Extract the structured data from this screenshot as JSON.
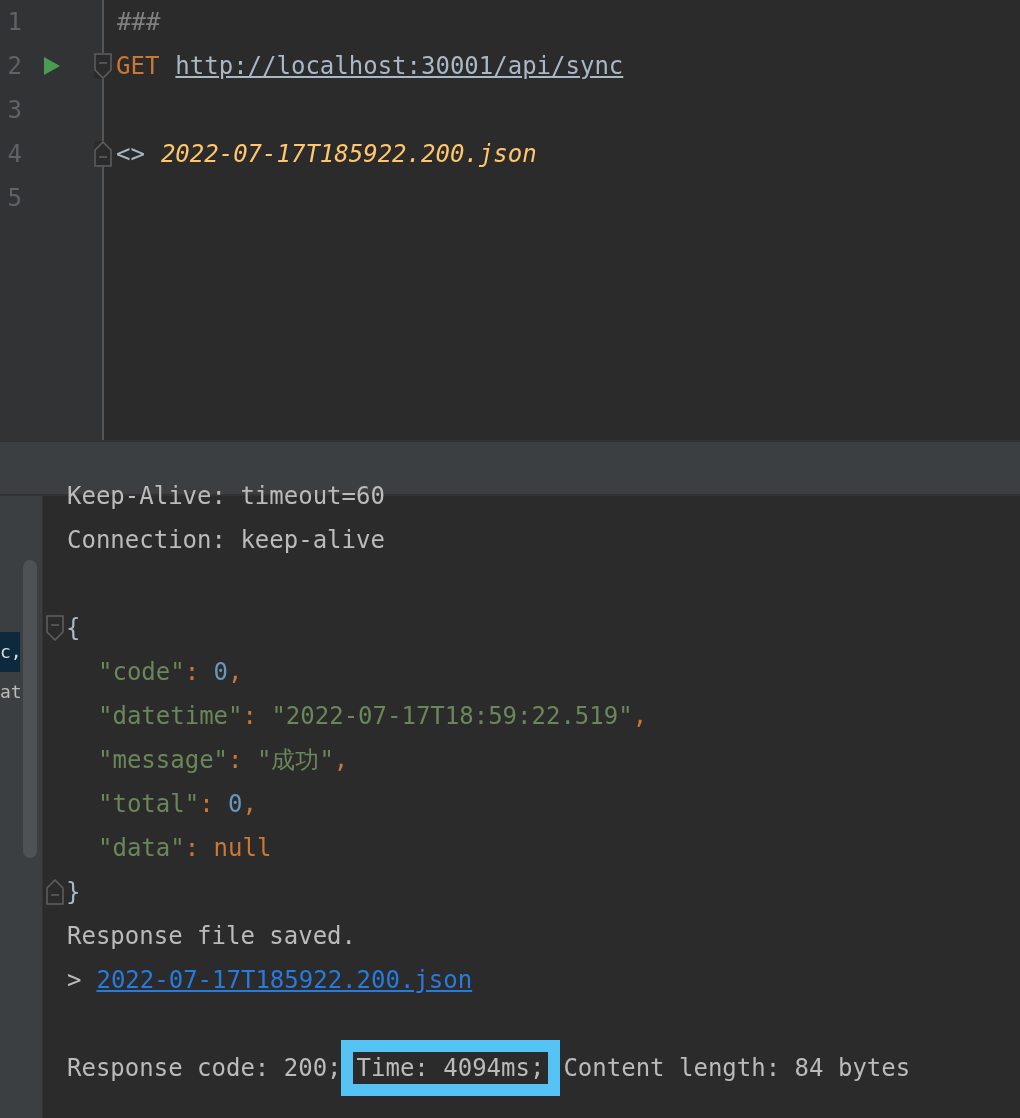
{
  "editor": {
    "lines": [
      {
        "number": "1",
        "kind": "comment",
        "text": "###"
      },
      {
        "number": "2",
        "kind": "request",
        "method": "GET",
        "url": "http://localhost:30001/api/sync",
        "runnable": true
      },
      {
        "number": "3",
        "kind": "blank"
      },
      {
        "number": "4",
        "kind": "response_ref",
        "marker": "<>",
        "file": "2022-07-17T185922.200.json"
      },
      {
        "number": "5",
        "kind": "blank"
      }
    ]
  },
  "side_panel": {
    "items": [
      {
        "text": "c,",
        "selected": true
      },
      {
        "text": "at",
        "selected": false
      }
    ]
  },
  "console": {
    "lines": [
      {
        "kind": "text",
        "text": "Keep-Alive: timeout=60"
      },
      {
        "kind": "text",
        "text": "Connection: keep-alive"
      },
      {
        "kind": "blank"
      },
      {
        "kind": "brace",
        "text": "{"
      },
      {
        "kind": "field",
        "tokens": [
          {
            "kind": "key",
            "text": "\"code\""
          },
          {
            "kind": "punct",
            "text": ": "
          },
          {
            "kind": "number",
            "text": "0"
          },
          {
            "kind": "punct",
            "text": ","
          }
        ]
      },
      {
        "kind": "field",
        "tokens": [
          {
            "kind": "key",
            "text": "\"datetime\""
          },
          {
            "kind": "punct",
            "text": ": "
          },
          {
            "kind": "string",
            "text": "\"2022-07-17T18:59:22.519\""
          },
          {
            "kind": "punct",
            "text": ","
          }
        ]
      },
      {
        "kind": "field",
        "tokens": [
          {
            "kind": "key",
            "text": "\"message\""
          },
          {
            "kind": "punct",
            "text": ": "
          },
          {
            "kind": "string",
            "text": "\"成功\""
          },
          {
            "kind": "punct",
            "text": ","
          }
        ]
      },
      {
        "kind": "field",
        "tokens": [
          {
            "kind": "key",
            "text": "\"total\""
          },
          {
            "kind": "punct",
            "text": ": "
          },
          {
            "kind": "number",
            "text": "0"
          },
          {
            "kind": "punct",
            "text": ","
          }
        ]
      },
      {
        "kind": "field",
        "tokens": [
          {
            "kind": "key",
            "text": "\"data\""
          },
          {
            "kind": "punct",
            "text": ": "
          },
          {
            "kind": "keyword",
            "text": "null"
          }
        ]
      },
      {
        "kind": "brace",
        "text": "}"
      },
      {
        "kind": "text",
        "text": "Response file saved."
      },
      {
        "kind": "link",
        "prefix": ">",
        "text": "2022-07-17T185922.200.json"
      },
      {
        "kind": "blank"
      },
      {
        "kind": "status",
        "parts": [
          {
            "text": "Response code: 200;",
            "highlighted": false
          },
          {
            "text": "Time: 4094ms;",
            "highlighted": true
          },
          {
            "text": "Content length: 84 bytes",
            "highlighted": false
          }
        ]
      }
    ]
  }
}
